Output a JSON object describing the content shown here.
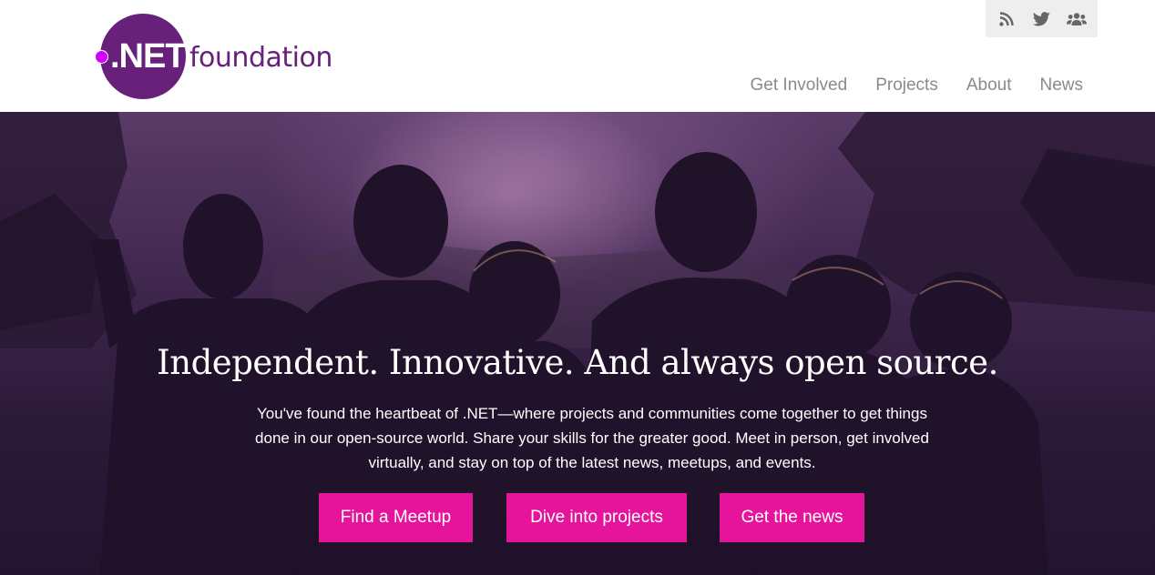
{
  "brand": {
    "logo_mark_text": ".NET",
    "logo_word": "foundation",
    "colors": {
      "purple": "#68217a",
      "dot": "#d100ff",
      "cta": "#e5149a"
    }
  },
  "social": [
    {
      "icon": "rss-icon"
    },
    {
      "icon": "twitter-icon"
    },
    {
      "icon": "users-icon"
    }
  ],
  "nav": {
    "items": [
      {
        "label": "Get Involved"
      },
      {
        "label": "Projects"
      },
      {
        "label": "About"
      },
      {
        "label": "News"
      }
    ]
  },
  "hero": {
    "title": "Independent. Innovative. And always open source.",
    "text": "You've found the heartbeat of .NET—where projects and communities come together to get things done in our open-source world. Share your skills for the greater good. Meet in person, get involved virtually, and stay on top of the latest news, meetups, and events.",
    "buttons": [
      {
        "label": "Find a Meetup"
      },
      {
        "label": "Dive into projects"
      },
      {
        "label": "Get the news"
      }
    ]
  }
}
